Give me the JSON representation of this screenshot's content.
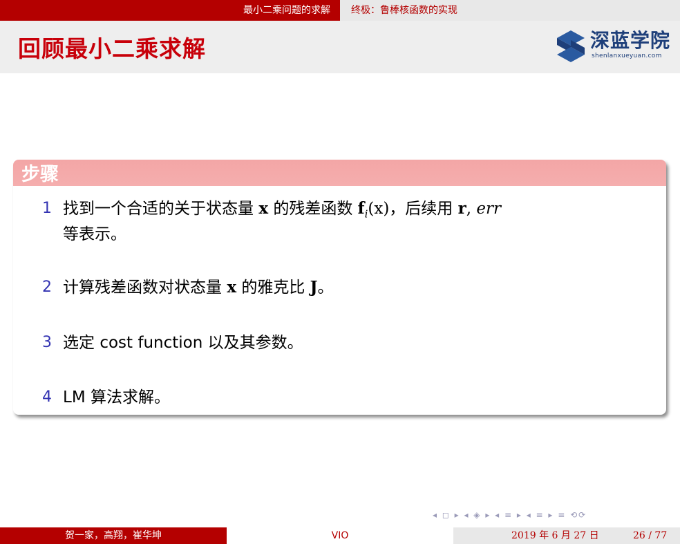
{
  "header": {
    "current_section": "最小二乘问题的求解",
    "next_section": "终极：鲁棒核函数的实现"
  },
  "frame": {
    "title": "回顾最小二乘求解"
  },
  "logo": {
    "name": "深蓝学院",
    "url": "shenlanxueyuan.com"
  },
  "block": {
    "title": "步骤",
    "items": [
      {
        "number": "1",
        "line1_a": "找到一个合适的关于状态量",
        "x": "x",
        "line1_b": "的残差函数",
        "f": "f",
        "sub_i": "i",
        "paren_x": "(x)",
        "line1_c": "，后续用",
        "r": "r",
        "comma": ",",
        "err": "err",
        "line2": "等表示。"
      },
      {
        "number": "2",
        "text_a": "计算残差函数对状态量",
        "x": "x",
        "text_b": "的雅克比",
        "J": "J",
        "end": "。"
      },
      {
        "number": "3",
        "text_a": "选定",
        "cost": "cost function",
        "text_b": "以及其参数。"
      },
      {
        "number": "4",
        "lm": "LM",
        "text_b": "算法求解。"
      }
    ]
  },
  "nav_symbols": "◂ ◻ ▸ ◂ ◈ ▸ ◂ ≡ ▸ ◂ ≡ ▸   ≡   ⟲⟳",
  "footer": {
    "authors": "贺一家，高翔，崔华坤",
    "short_title": "VIO",
    "date": "2019 年 6 月 27 日",
    "page": "26 / 77"
  },
  "colors": {
    "accent": "#b40000",
    "title_red": "#c8000a",
    "block_header": "#f4a9a9",
    "item_number": "#3333b2",
    "logo_blue": "#1e3f7a"
  }
}
